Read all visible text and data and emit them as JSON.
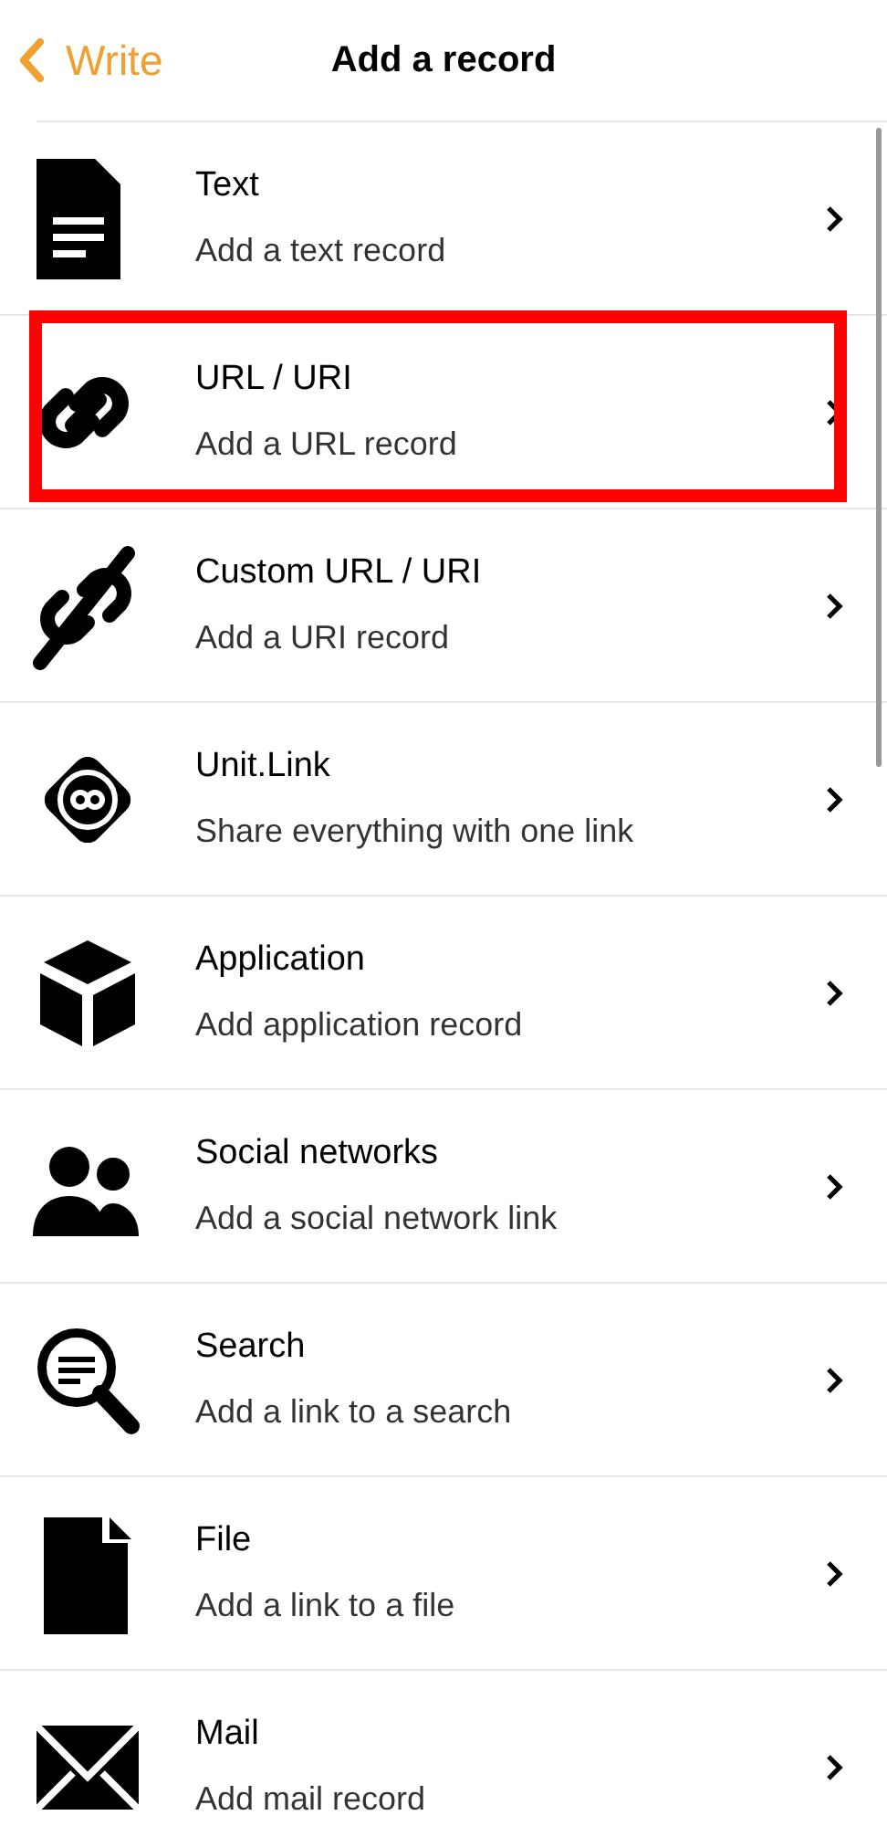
{
  "nav": {
    "back": "Write",
    "title": "Add a record"
  },
  "items": [
    {
      "kind": "text",
      "title": "Text",
      "subtitle": "Add a text record",
      "highlighted": false
    },
    {
      "kind": "link",
      "title": "URL / URI",
      "subtitle": "Add a URL record",
      "highlighted": true
    },
    {
      "kind": "custom-link",
      "title": "Custom URL / URI",
      "subtitle": "Add a URI record",
      "highlighted": false
    },
    {
      "kind": "unit",
      "title": "Unit.Link",
      "subtitle": "Share everything with one link",
      "highlighted": false
    },
    {
      "kind": "app",
      "title": "Application",
      "subtitle": "Add application record",
      "highlighted": false
    },
    {
      "kind": "social",
      "title": "Social networks",
      "subtitle": "Add a social network link",
      "highlighted": false
    },
    {
      "kind": "search",
      "title": "Search",
      "subtitle": "Add a link to a search",
      "highlighted": false
    },
    {
      "kind": "file",
      "title": "File",
      "subtitle": "Add a link to a file",
      "highlighted": false
    },
    {
      "kind": "mail",
      "title": "Mail",
      "subtitle": "Add mail record",
      "highlighted": false
    }
  ]
}
